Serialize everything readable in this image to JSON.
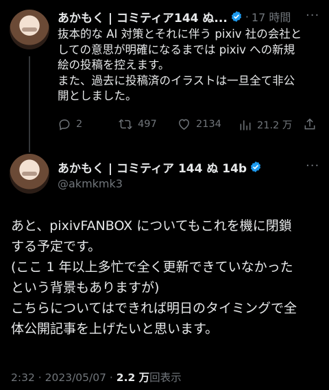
{
  "tweet1": {
    "display_name": "あかもく | コミティア144 ぬ...",
    "dot": "·",
    "time_ago": "17 時間",
    "text": "抜本的な AI 対策とそれに伴う pixiv 社の会社と\nしての意思が明確になるまでは pixiv への新規\n絵の投稿を控えます。\nまた、過去に投稿済のイラストは一旦全て非公\n開としました。",
    "replies": "2",
    "retweets": "497",
    "likes": "2134",
    "views": "21.2 万"
  },
  "tweet2": {
    "display_name": "あかもく | コミティア 144 ぬ 14b",
    "handle": "@akmkmk3",
    "text": "あと、pixivFANBOX についてもこれを機に閉鎖\nする予定です。\n(ここ 1 年以上多忙で全く更新できていなかった\nという背景もありますが)\nこちらについてはできれば明日のタイミングで全\n体公開記事を上げたいと思います。",
    "time": "2:32",
    "sep": "·",
    "date": "2023/05/07",
    "views_count": "2.2 万",
    "views_label": "回表示"
  },
  "colors": {
    "background": "#000000",
    "text": "#e7e9ea",
    "muted": "#71767b",
    "verified": "#1d9bf0",
    "thread_line": "#333639"
  },
  "icons": [
    "verified-badge-icon",
    "more-icon",
    "reply-icon",
    "retweet-icon",
    "like-icon",
    "views-icon",
    "share-icon"
  ]
}
